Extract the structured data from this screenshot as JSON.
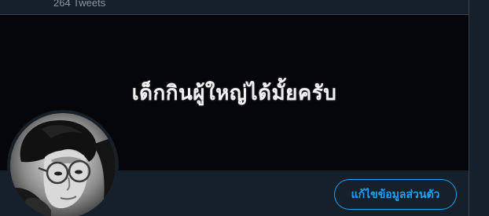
{
  "header": {
    "tweet_count": "264 Tweets"
  },
  "banner": {
    "text": "เด็กกินผู้ใหญ่ได้มั้ยครับ"
  },
  "profile": {
    "avatar_icon": "avatar-photo-icon",
    "edit_profile_label": "แก้ไขข้อมูลส่วนตัว"
  },
  "colors": {
    "background": "#15202b",
    "banner_background": "#05060a",
    "accent": "#1da1f2",
    "muted_text": "#8899a6",
    "border": "#38444d"
  }
}
